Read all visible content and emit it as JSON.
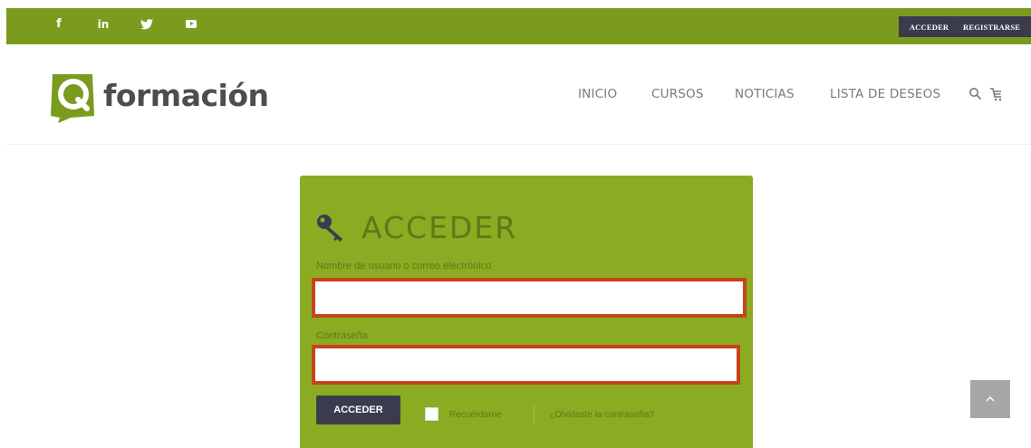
{
  "topbar": {
    "social": [
      {
        "name": "facebook",
        "glyph": "f"
      },
      {
        "name": "linkedin",
        "glyph": "in"
      },
      {
        "name": "twitter",
        "glyph": "y"
      },
      {
        "name": "youtube",
        "glyph": ""
      }
    ],
    "login_label": "ACCEDER",
    "register_label": "REGISTRARSE"
  },
  "header": {
    "logo_letter": "Q",
    "logo_text": "formación",
    "nav": [
      "INICIO",
      "CURSOS",
      "NOTICIAS",
      "LISTA DE DESEOS"
    ],
    "icons": [
      "search-icon",
      "cart-icon"
    ]
  },
  "login_form": {
    "title": "ACCEDER",
    "username_label": "Nombre de usuario o correo electrónico",
    "username_value": "",
    "password_label": "Contraseña",
    "password_value": "",
    "submit_label": "ACCEDER",
    "remember_label": "Recuérdame",
    "lost_password_label": "¿Olvidaste la contraseña?"
  },
  "colors": {
    "brand_green": "#7b9b1e",
    "panel_green": "#8aab22",
    "dark_button": "#3a3c4d",
    "highlight_border": "#c8431a"
  }
}
